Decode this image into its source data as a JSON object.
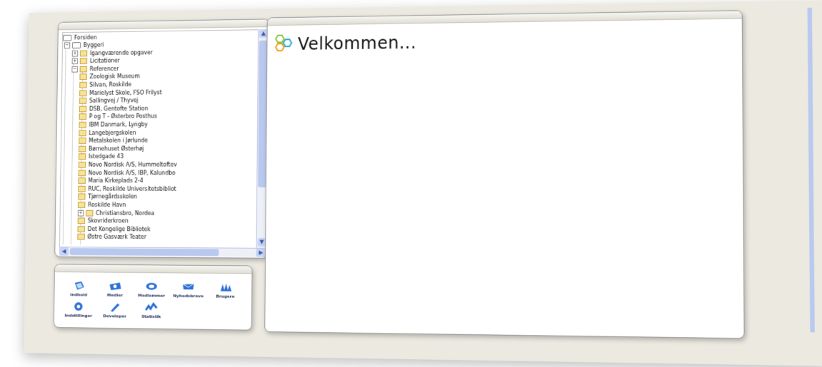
{
  "tree": {
    "root_label": "Forsiden",
    "items": [
      {
        "label": "Byggeri",
        "level": 1,
        "expander": "−",
        "icon": "folder-icon"
      },
      {
        "label": "Igangværende opgaver",
        "level": 2,
        "expander": "+",
        "icon": "page-icon"
      },
      {
        "label": "Licitationer",
        "level": 2,
        "expander": "+",
        "icon": "page-icon"
      },
      {
        "label": "Referencer",
        "level": 2,
        "expander": "−",
        "icon": "page-icon"
      },
      {
        "label": "Zoologisk Museum",
        "level": 3,
        "icon": "page-icon"
      },
      {
        "label": "Silvan, Roskilde",
        "level": 3,
        "icon": "page-icon"
      },
      {
        "label": "Marielyst Skole, FSO Frilyst",
        "level": 3,
        "icon": "page-icon"
      },
      {
        "label": "Sallingvej / Thyvej",
        "level": 3,
        "icon": "page-icon"
      },
      {
        "label": "DSB, Gentofte Station",
        "level": 3,
        "icon": "page-icon"
      },
      {
        "label": "P og T - Østerbro Posthus",
        "level": 3,
        "icon": "page-icon"
      },
      {
        "label": "IBM Danmark, Lyngby",
        "level": 3,
        "icon": "page-icon"
      },
      {
        "label": "Langebjergskolen",
        "level": 3,
        "icon": "page-icon"
      },
      {
        "label": "Metalskolen i Jørlunde",
        "level": 3,
        "icon": "page-icon"
      },
      {
        "label": "Børnehuset Østerhøj",
        "level": 3,
        "icon": "page-icon"
      },
      {
        "label": "Istedgade 43",
        "level": 3,
        "icon": "page-icon"
      },
      {
        "label": "Novo Nordisk A/S, Hummeltoftev",
        "level": 3,
        "icon": "page-icon"
      },
      {
        "label": "Novo Nordisk A/S, IBP, Kalundbo",
        "level": 3,
        "icon": "page-icon"
      },
      {
        "label": "Maria Kirkeplads 2-4",
        "level": 3,
        "icon": "page-icon"
      },
      {
        "label": "RUC, Roskilde Universitetsbibliot",
        "level": 3,
        "icon": "page-icon"
      },
      {
        "label": "Tjørnegårdsskolen",
        "level": 3,
        "icon": "page-icon"
      },
      {
        "label": "Roskilde Havn",
        "level": 3,
        "icon": "page-icon"
      },
      {
        "label": "Christiansbro, Nordea",
        "level": 3,
        "expander": "+",
        "icon": "page-icon"
      },
      {
        "label": "Skovriderkroen",
        "level": 3,
        "icon": "page-icon"
      },
      {
        "label": "Det Kongelige Bibliotek",
        "level": 3,
        "icon": "page-icon"
      },
      {
        "label": "Østre Gasværk Teater",
        "level": 3,
        "icon": "page-icon"
      }
    ]
  },
  "dashboard": {
    "items": [
      {
        "label": "Indhold",
        "icon": "content-icon"
      },
      {
        "label": "Medier",
        "icon": "media-icon"
      },
      {
        "label": "Medlemmer",
        "icon": "members-icon"
      },
      {
        "label": "Nyhedsbreve",
        "icon": "newsletter-icon"
      },
      {
        "label": "Brugere",
        "icon": "users-icon"
      },
      {
        "label": "Indstillinger",
        "icon": "settings-icon"
      },
      {
        "label": "Developer",
        "icon": "developer-icon"
      },
      {
        "label": "Statistik",
        "icon": "statistics-icon"
      }
    ]
  },
  "main": {
    "welcome_text": "Velkommen..."
  },
  "colors": {
    "accent": "#1a6fc9",
    "logo_orange": "#f0a21b",
    "logo_green": "#8dc63f",
    "logo_blue": "#2aa8e0",
    "scroll": "#b9c8ee"
  }
}
